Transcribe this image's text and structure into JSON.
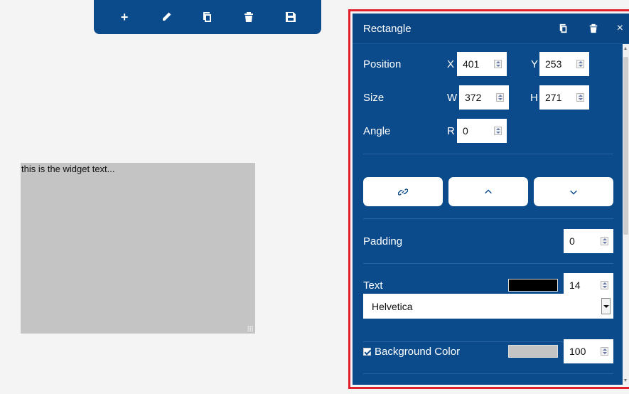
{
  "toolbar": {
    "buttons": [
      {
        "icon": "plus-icon"
      },
      {
        "icon": "pencil-icon"
      },
      {
        "icon": "copy-icon"
      },
      {
        "icon": "trash-icon"
      },
      {
        "icon": "save-icon"
      }
    ],
    "plus_glyph": "+"
  },
  "widget": {
    "text": "this is the widget text...",
    "background": "#c4c4c4"
  },
  "panel": {
    "title": "Rectangle",
    "close_glyph": "×",
    "position_label": "Position",
    "x_label": "X",
    "x_value": "401",
    "y_label": "Y",
    "y_value": "253",
    "size_label": "Size",
    "w_label": "W",
    "w_value": "372",
    "h_label": "H",
    "h_value": "271",
    "angle_label": "Angle",
    "r_label": "R",
    "r_value": "0",
    "action_buttons": [
      {
        "icon": "link-icon"
      },
      {
        "icon": "chevron-up-icon"
      },
      {
        "icon": "chevron-down-icon"
      }
    ],
    "padding_label": "Padding",
    "padding_value": "0",
    "text_label": "Text",
    "text_color": "#000000",
    "text_size": "14",
    "font_family_value": "Helvetica",
    "bg_color_label": "Background Color",
    "bg_color_checked": true,
    "bg_color": "#c4c4c4",
    "bg_opacity": "100"
  },
  "colors": {
    "panel_bg": "#0b4a8b",
    "highlight_border": "#e0202b"
  }
}
